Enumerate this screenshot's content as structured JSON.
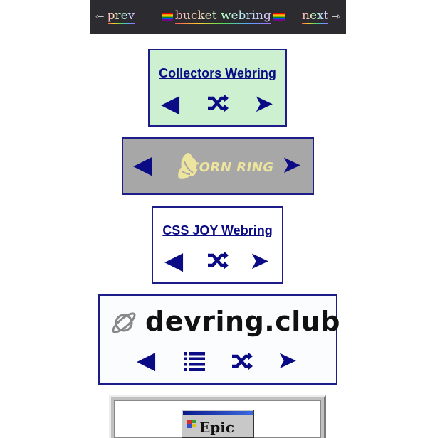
{
  "bucket_webring": {
    "prev_arrow": "⇽",
    "prev_label": "prev",
    "title": "bucket webring",
    "next_label": "next",
    "next_arrow": "⇾",
    "colors": {
      "background": "#2c2c30"
    }
  },
  "collectors_webring": {
    "title": "Collectors Webring",
    "prev": "◀",
    "random_icon": "shuffle-icon",
    "next": "➤",
    "colors": {
      "background": "#cdf0d0",
      "text": "#0b0b86"
    }
  },
  "corn_ring": {
    "prev": "◀",
    "logo_text": "CORN RING",
    "next": "➤",
    "colors": {
      "background": "#a7a7a7",
      "logo": "#ede59e"
    }
  },
  "css_joy_webring": {
    "title": "CSS JOY Webring",
    "prev": "◀",
    "random_icon": "shuffle-icon",
    "next": "➤"
  },
  "devring": {
    "name": "devring.club",
    "logo_icon": "planet-icon",
    "prev": "◀",
    "list_icon": "list-icon",
    "random_icon": "shuffle-icon",
    "next": "➤"
  },
  "epic_webring": {
    "label": "Epic"
  }
}
